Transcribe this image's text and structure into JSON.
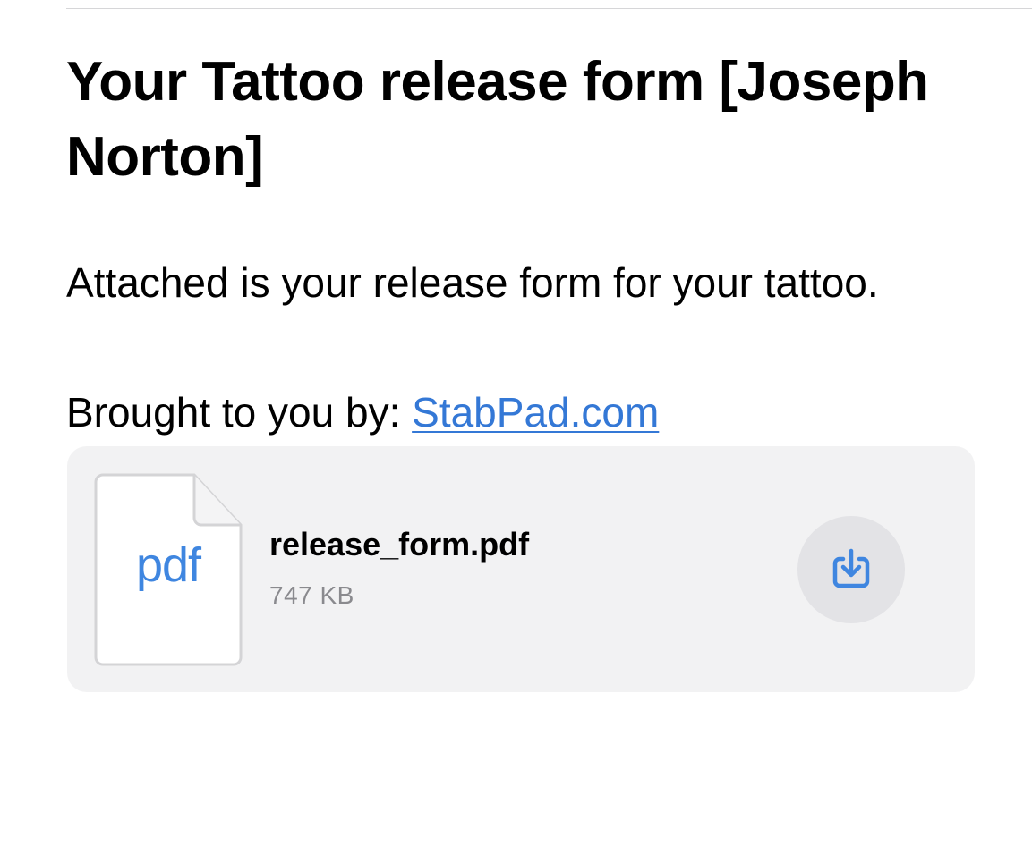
{
  "email": {
    "subject": "Your Tattoo release form [Joseph Norton]",
    "body_line_1": "Attached is your release form for your tattoo.",
    "brought_by_label": "Brought to you by: ",
    "brought_by_link": "StabPad.com"
  },
  "attachment": {
    "file_type_label": "pdf",
    "file_name": "release_form.pdf",
    "file_size": "747 KB",
    "file_icon": "pdf-document-icon",
    "action_icon": "download-icon"
  },
  "colors": {
    "link": "#3478d6",
    "accent_icon": "#3f86e0",
    "attachment_bg": "#f2f2f3",
    "button_bg": "#e3e3e6",
    "secondary_text": "#8a8a8e"
  }
}
